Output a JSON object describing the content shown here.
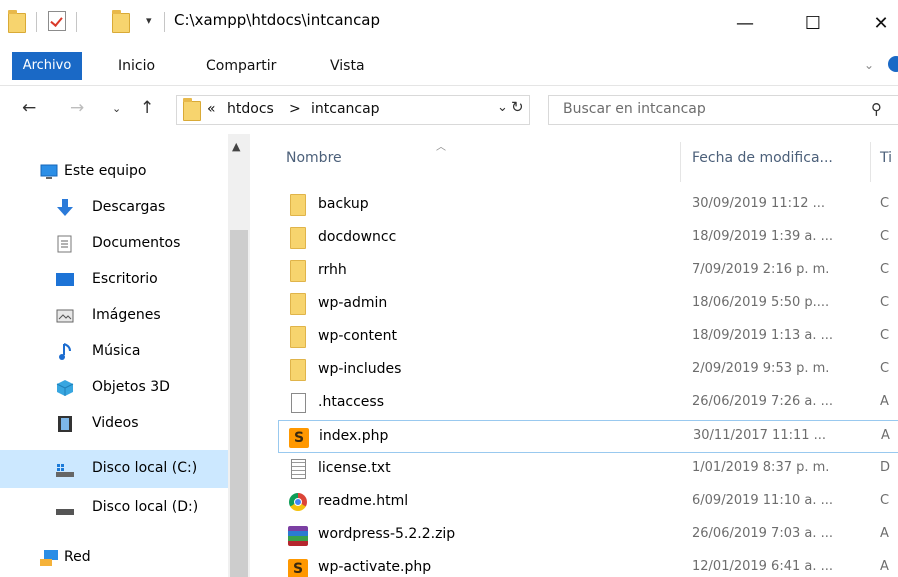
{
  "titlebar": {
    "path": "C:\\xampp\\htdocs\\intcancap",
    "minimize": "—",
    "maximize": "☐",
    "close": "✕"
  },
  "ribbon": {
    "tabs": [
      "Archivo",
      "Inicio",
      "Compartir",
      "Vista"
    ]
  },
  "address": {
    "overflow": "«",
    "crumbs": [
      "htdocs",
      ">",
      "intcancap"
    ],
    "search_placeholder": "Buscar en intcancap"
  },
  "navpane": {
    "items": [
      {
        "label": "Este equipo",
        "icon": "monitor-icon"
      },
      {
        "label": "Descargas",
        "icon": "download-arrow-icon"
      },
      {
        "label": "Documentos",
        "icon": "document-icon"
      },
      {
        "label": "Escritorio",
        "icon": "desktop-icon"
      },
      {
        "label": "Imágenes",
        "icon": "picture-icon"
      },
      {
        "label": "Música",
        "icon": "music-note-icon"
      },
      {
        "label": "Objetos 3D",
        "icon": "cube-3d-icon"
      },
      {
        "label": "Videos",
        "icon": "film-icon"
      },
      {
        "label": "Disco local (C:)",
        "icon": "windows-drive-icon",
        "selected": true
      },
      {
        "label": "Disco local (D:)",
        "icon": "drive-icon"
      },
      {
        "label": "Red",
        "icon": "network-icon"
      }
    ]
  },
  "columns": {
    "name": "Nombre",
    "date": "Fecha de modifica...",
    "type": "Ti"
  },
  "files": [
    {
      "name": "backup",
      "date": "30/09/2019 11:12 ...",
      "type": "C",
      "icon": "folder"
    },
    {
      "name": "docdowncc",
      "date": "18/09/2019 1:39 a. ...",
      "type": "C",
      "icon": "folder"
    },
    {
      "name": "rrhh",
      "date": "7/09/2019 2:16 p. m.",
      "type": "C",
      "icon": "folder"
    },
    {
      "name": "wp-admin",
      "date": "18/06/2019 5:50 p....",
      "type": "C",
      "icon": "folder"
    },
    {
      "name": "wp-content",
      "date": "18/09/2019 1:13 a. ...",
      "type": "C",
      "icon": "folder"
    },
    {
      "name": "wp-includes",
      "date": "2/09/2019 9:53 p. m.",
      "type": "C",
      "icon": "folder"
    },
    {
      "name": ".htaccess",
      "date": "26/06/2019 7:26 a. ...",
      "type": "A",
      "icon": "blank-file"
    },
    {
      "name": "index.php",
      "date": "30/11/2017 11:11 ...",
      "type": "A",
      "icon": "sublime",
      "focused": true
    },
    {
      "name": "license.txt",
      "date": "1/01/2019 8:37 p. m.",
      "type": "D",
      "icon": "text-file"
    },
    {
      "name": "readme.html",
      "date": "6/09/2019 11:10 a. ...",
      "type": "C",
      "icon": "chrome"
    },
    {
      "name": "wordpress-5.2.2.zip",
      "date": "26/06/2019 7:03 a. ...",
      "type": "A",
      "icon": "winrar"
    },
    {
      "name": "wp-activate.php",
      "date": "12/01/2019 6:41 a. ...",
      "type": "A",
      "icon": "sublime"
    }
  ]
}
